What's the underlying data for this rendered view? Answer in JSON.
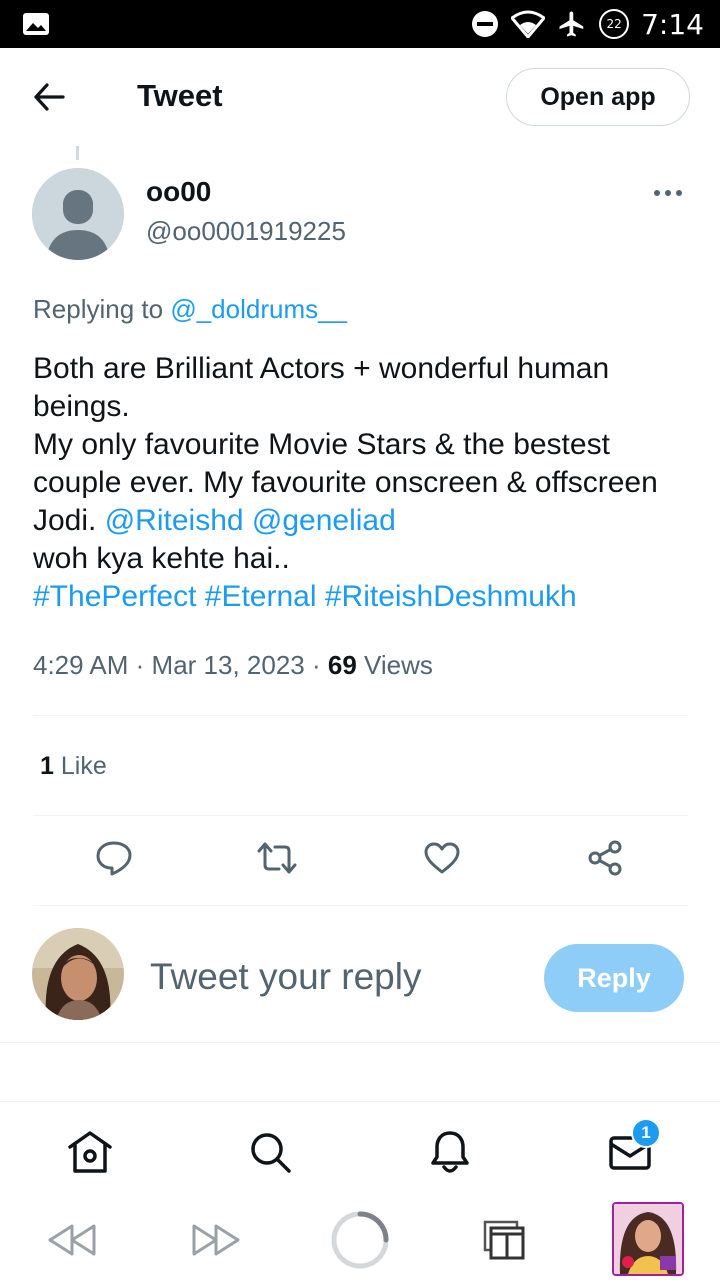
{
  "status_bar": {
    "time": "7:14",
    "notification_count": "22",
    "icons": [
      "gallery-icon",
      "do-not-disturb-icon",
      "wifi-icon",
      "airplane-icon",
      "notification-count-icon"
    ]
  },
  "header": {
    "title": "Tweet",
    "open_app_label": "Open app",
    "back_icon": "arrow-left-icon"
  },
  "tweet": {
    "author_name": "oo00",
    "author_handle": "@oo0001919225",
    "replying_prefix": "Replying to",
    "replying_to": "@_doldrums__",
    "body": {
      "line1": "Both are Brilliant Actors + wonderful human beings.",
      "line2": "My only favourite Movie Stars & the bestest couple ever. My favourite onscreen & offscreen Jodi.",
      "mention1": "@Riteishd",
      "mention2": "@geneliad",
      "line3": "woh kya kehte hai..",
      "hashtag1": "#ThePerfect",
      "hashtag2": "#Eternal",
      "hashtag3": "#RiteishDeshmukh"
    },
    "time": "4:29 AM",
    "date": "Mar 13, 2023",
    "views_count": "69",
    "views_label": "Views",
    "likes_count": "1",
    "likes_label": "Like"
  },
  "reply": {
    "placeholder": "Tweet your reply",
    "button_label": "Reply"
  },
  "bottom_nav": {
    "items": [
      "home-icon",
      "search-icon",
      "notifications-icon",
      "messages-icon"
    ],
    "messages_badge": "1"
  },
  "browser_bar": {
    "items": [
      "back-icon",
      "forward-icon",
      "loading-icon",
      "tabs-icon",
      "thumbnail"
    ]
  },
  "colors": {
    "accent": "#1d9bf0",
    "reply_button": "#8ecdf8",
    "text_secondary": "#536471"
  }
}
